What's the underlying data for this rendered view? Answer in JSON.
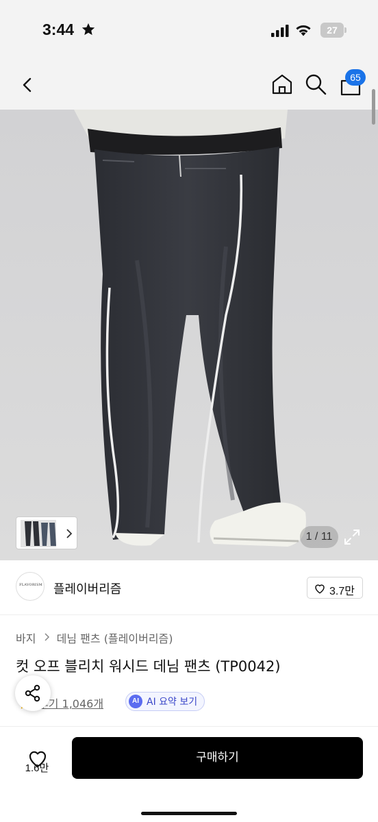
{
  "status": {
    "time": "3:44",
    "battery": "27"
  },
  "nav": {
    "cart_count": "65"
  },
  "gallery": {
    "counter": "1 / 11"
  },
  "brand": {
    "name": "플레이버리즘",
    "logo_text": "FLAVORISM",
    "likes": "3.7만"
  },
  "breadcrumb": {
    "category": "바지",
    "sub_category": "데님 팬츠 (플레이버리즘)"
  },
  "product": {
    "title": "컷 오프 블리치 워시드 데님 팬츠 (TP0042)",
    "reviews": "후기 1,046개",
    "ai_badge": "AI",
    "ai_summary": "AI 요약 보기"
  },
  "bottom": {
    "like_count": "1.6만",
    "buy_label": "구매하기"
  }
}
